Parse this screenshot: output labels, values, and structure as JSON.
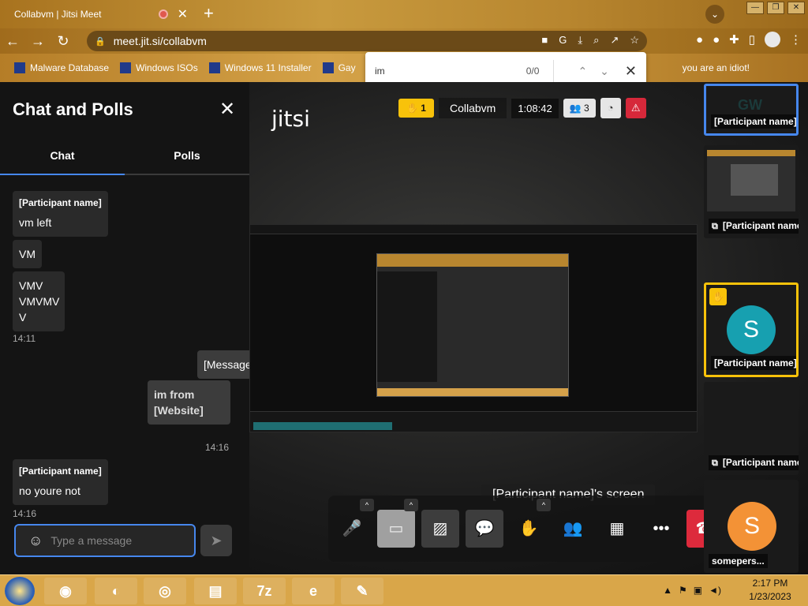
{
  "browser": {
    "tab_title": "Collabvm | Jitsi Meet",
    "url": "meet.jit.si/collabvm",
    "bookmarks": [
      "Malware Database",
      "Windows ISOs",
      "Windows 11 Installer",
      "Gay",
      "you are an idiot!"
    ]
  },
  "findbar": {
    "query": "im",
    "count": "0/0"
  },
  "chat": {
    "title": "Chat and Polls",
    "tabs": [
      "Chat",
      "Polls"
    ],
    "messages": [
      {
        "sender": "[Participant name]",
        "lines": [
          "vm left",
          "VM",
          "VMV VMVMV V"
        ],
        "time": "14:11"
      },
      {
        "mine": true,
        "lines": [
          "[Message]",
          "im from [Website]"
        ],
        "time": "14:16"
      },
      {
        "sender": "[Participant name]",
        "lines": [
          "no youre not"
        ],
        "time": "14:16"
      }
    ],
    "input_placeholder": "Type a message"
  },
  "meeting": {
    "logo": "jitsi",
    "raised_hands": "1",
    "name": "Collabvm",
    "timer": "1:08:42",
    "participants": "3",
    "screen_label": "[Participant name]'s screen"
  },
  "tiles": [
    {
      "name": "[Participant name]",
      "initials": "GW"
    },
    {
      "name": "[Participant name]"
    },
    {
      "name": "[Participant name]",
      "initial": "S",
      "color": "#17a0b0"
    },
    {
      "name": "[Participant name]'s scr..."
    },
    {
      "name": "somepers...",
      "initial": "S",
      "color": "#f39236"
    }
  ],
  "taskbar": {
    "time": "2:17 PM",
    "date": "1/23/2023",
    "sevenzip": "7z",
    "ie": "e"
  }
}
